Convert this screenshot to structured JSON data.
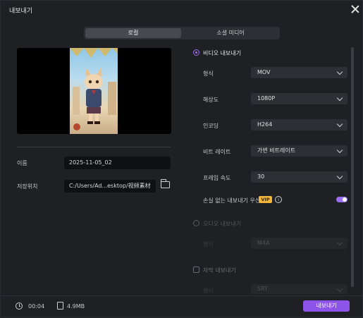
{
  "window": {
    "title": "내보내기"
  },
  "tabs": [
    "로컬",
    "소셜 미디어"
  ],
  "left": {
    "name_label": "이름",
    "name_value": "2025-11-05_02",
    "location_label": "저장위치",
    "location_value": "C:/Users/Ad...esktop/视频素材"
  },
  "video": {
    "section_label": "비디오 내보내기",
    "fields": [
      {
        "label": "형식",
        "value": "MOV"
      },
      {
        "label": "해상도",
        "value": "1080P"
      },
      {
        "label": "인코딩",
        "value": "H264"
      },
      {
        "label": "비트 레이트",
        "value": "가변 비트레이트"
      },
      {
        "label": "프레임 속도",
        "value": "30"
      }
    ],
    "lossless_label": "손실 없는 내보내기 우선",
    "vip_badge": "VIP",
    "info_glyph": "i",
    "lossless_enabled": true
  },
  "audio": {
    "section_label": "오디오 내보내기",
    "format_label": "형식",
    "format_value": "M4A"
  },
  "subtitle": {
    "section_label": "자막 내보내기",
    "format_label": "형식",
    "format_value": "SRT"
  },
  "footer": {
    "duration": "00:04",
    "size": "4.9MB",
    "export_label": "내보내기"
  },
  "colors": {
    "accent": "#9b6ff0",
    "export_button": "#8d54ea",
    "vip": "#f2b53a"
  }
}
